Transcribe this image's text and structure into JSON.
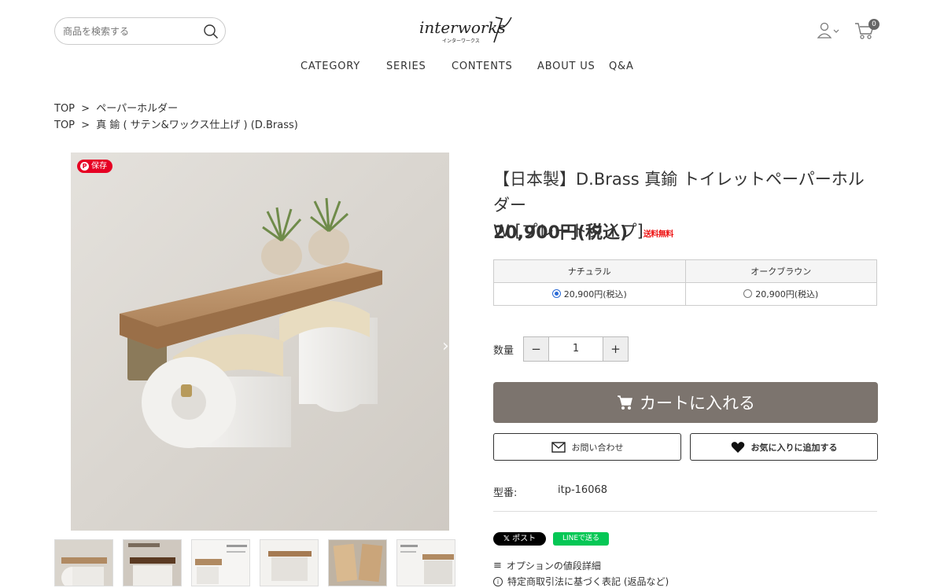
{
  "header": {
    "search_placeholder": "商品を検索する",
    "logo_text": "interworks",
    "logo_sub": "インターワークス",
    "cart_count": "0"
  },
  "nav": {
    "items": [
      {
        "label": "CATEGORY"
      },
      {
        "label": "SERIES"
      },
      {
        "label": "CONTENTS"
      },
      {
        "label": "ABOUT US"
      },
      {
        "label": "Q&A"
      }
    ]
  },
  "breadcrumbs": [
    [
      "TOP",
      ">",
      "ペーパーホルダー"
    ],
    [
      "TOP",
      ">",
      "真 鍮 ( サテン&ワックス仕上げ ) (D.Brass)"
    ]
  ],
  "gallery": {
    "save_label": "保存",
    "thumbnail_count": 6
  },
  "product": {
    "title_line1": "【日本製】D.Brass 真鍮 トイレットペーパーホルダー",
    "title_line2": "W [プレートタイプ]",
    "free_shipping": "送料無料",
    "price": "20,900円(税込)",
    "options": {
      "headers": [
        "ナチュラル",
        "オークブラウン"
      ],
      "prices": [
        "20,900円(税込)",
        "20,900円(税込)"
      ],
      "selected_index": 0
    },
    "quantity_label": "数量",
    "quantity": "1",
    "minus_label": "−",
    "plus_label": "+",
    "cart_button": "カートに入れる",
    "inquiry_button": "お問い合わせ",
    "favorite_button": "お気に入りに追加する",
    "model_label": "型番:",
    "model_value": "itp-16068",
    "share_x": "ポスト",
    "share_line": "LINEで送る",
    "link_option_detail": "オプションの値段詳細",
    "link_law": "特定商取引法に基づく表記 (返品など)"
  },
  "colors": {
    "cart_button_bg": "#7c746e",
    "pinterest": "#e60023",
    "line_green": "#06c755",
    "free_shipping_red": "#e11111"
  }
}
